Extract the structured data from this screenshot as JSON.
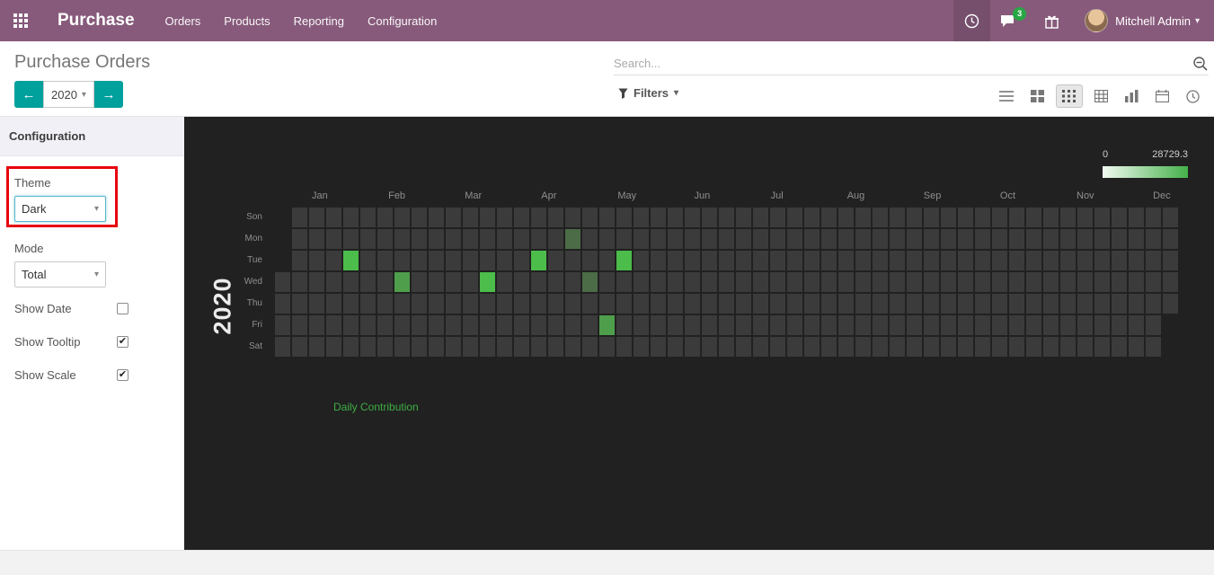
{
  "navbar": {
    "app_title": "Purchase",
    "menu": [
      "Orders",
      "Products",
      "Reporting",
      "Configuration"
    ],
    "messages_badge": "3",
    "user_name": "Mitchell Admin"
  },
  "control_panel": {
    "breadcrumb": "Purchase Orders",
    "search_placeholder": "Search...",
    "filters_label": "Filters",
    "year_selector": "2020"
  },
  "sidebar": {
    "heading": "Configuration",
    "theme_label": "Theme",
    "theme_value": "Dark",
    "mode_label": "Mode",
    "mode_value": "Total",
    "toggles": [
      {
        "label": "Show Date",
        "checked": false
      },
      {
        "label": "Show Tooltip",
        "checked": true
      },
      {
        "label": "Show Scale",
        "checked": true
      }
    ]
  },
  "chart_data": {
    "type": "heatmap",
    "title": "Daily Contribution",
    "year": "2020",
    "months": [
      "Jan",
      "Feb",
      "Mar",
      "Apr",
      "May",
      "Jun",
      "Jul",
      "Aug",
      "Sep",
      "Oct",
      "Nov",
      "Dec"
    ],
    "day_labels": [
      "Son",
      "Mon",
      "Tue",
      "Wed",
      "Thu",
      "Fri",
      "Sat"
    ],
    "weeks": 53,
    "first_week_start_day": 3,
    "last_week_end_day": 4,
    "scale": {
      "min": "0",
      "max": "28729.3"
    },
    "colors": {
      "base": "#3a3b3a",
      "low": "#4c6b47",
      "mid": "#4f9e4c",
      "high": "#4cbc4b",
      "background": "#202120",
      "scale_start": "#f2faf1",
      "scale_end": "#44b14a",
      "title_green": "#3fae46"
    },
    "cells": [
      {
        "week": 4,
        "day": 2,
        "level": "high"
      },
      {
        "week": 15,
        "day": 2,
        "level": "high"
      },
      {
        "week": 20,
        "day": 2,
        "level": "high"
      },
      {
        "week": 7,
        "day": 3,
        "level": "mid"
      },
      {
        "week": 12,
        "day": 3,
        "level": "high"
      },
      {
        "week": 18,
        "day": 3,
        "level": "low"
      },
      {
        "week": 17,
        "day": 1,
        "level": "low"
      },
      {
        "week": 19,
        "day": 5,
        "level": "mid"
      }
    ]
  }
}
